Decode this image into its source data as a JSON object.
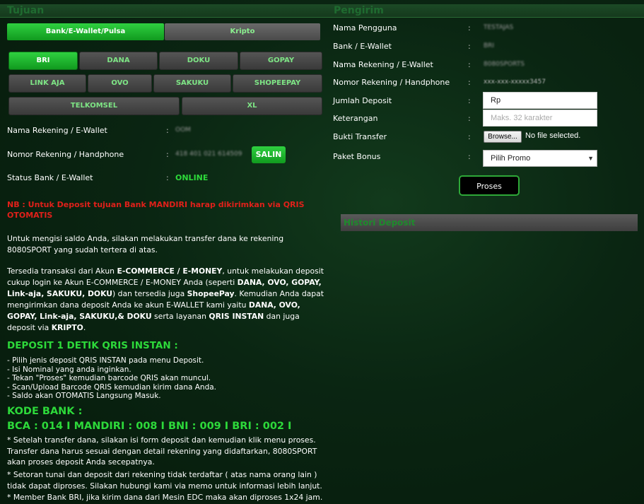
{
  "tujuan": {
    "heading": "Tujuan",
    "tabs": [
      {
        "label": "Bank/E-Wallet/Pulsa",
        "active": true
      },
      {
        "label": "Kripto",
        "active": false
      }
    ],
    "banks_row1": [
      "BRI",
      "DANA",
      "DOKU",
      "GOPAY"
    ],
    "banks_row2": [
      "LINK AJA",
      "OVO",
      "SAKUKU",
      "SHOPEEPAY"
    ],
    "banks_row3": [
      "TELKOMSEL",
      "XL"
    ],
    "selected_bank": "BRI",
    "fields": {
      "nama_label": "Nama Rekening / E-Wallet",
      "nama_value": "OOM",
      "nomor_label": "Nomor Rekening / Handphone",
      "nomor_value": "418 401 021 614509",
      "salin_label": "SALIN",
      "status_label": "Status Bank / E-Wallet",
      "status_value": "ONLINE",
      "colon": ":"
    },
    "nb_text": "NB : Untuk Deposit tujuan Bank MANDIRI harap dikirimkan via QRIS OTOMATIS",
    "para1": "Untuk mengisi saldo Anda, silakan melakukan transfer dana ke rekening 8080SPORT yang sudah tertera di atas.",
    "qris_heading": "DEPOSIT 1 DETIK QRIS INSTAN :",
    "steps": [
      "- Pilih jenis deposit QRIS INSTAN pada menu Deposit.",
      "- Isi Nominal yang anda inginkan.",
      "- Tekan \"Proses\" kemudian barcode QRIS akan muncul.",
      "- Scan/Upload Barcode QRIS kemudian kirim dana Anda.",
      "- Saldo akan OTOMATIS Langsung Masuk."
    ],
    "kode_heading": "KODE BANK :",
    "kode_values": "BCA : 014 I MANDIRI : 008 I BNI : 009 I BRI : 002 I",
    "notes": [
      "* Setelah transfer dana, silakan isi form deposit dan kemudian klik menu proses. Transfer dana harus sesuai dengan detail rekening yang didaftarkan, 8080SPORT akan proses deposit Anda secepatnya.",
      "* Setoran tunai dan deposit dari rekening tidak terdaftar ( atas nama orang lain ) tidak dapat diproses. Silakan hubungi kami via memo untuk informasi lebih lanjut.",
      "* Member Bank BRI, jika kirim dana dari Mesin EDC maka akan diproses 1x24 jam."
    ]
  },
  "pengirim": {
    "heading": "Pengirim",
    "colon": ":",
    "nama_pengguna_label": "Nama Pengguna",
    "nama_pengguna_value": "TESTAJAS",
    "bank_label": "Bank / E-Wallet",
    "bank_value": "BRI",
    "nama_rek_label": "Nama Rekening / E-Wallet",
    "nama_rek_value": "8080SPORTS",
    "nomor_label": "Nomor Rekening / Handphone",
    "nomor_value": "xxx-xxx-xxxxx3457",
    "jumlah_label": "Jumlah Deposit",
    "jumlah_value": "Rp",
    "keterangan_label": "Keterangan",
    "keterangan_placeholder": "Maks. 32 karakter",
    "bukti_label": "Bukti Transfer",
    "browse_label": "Browse...",
    "no_file": "No file selected.",
    "paket_label": "Paket Bonus",
    "paket_value": "Pilih Promo",
    "proses_label": "Proses",
    "history_label": "Histori Deposit"
  }
}
